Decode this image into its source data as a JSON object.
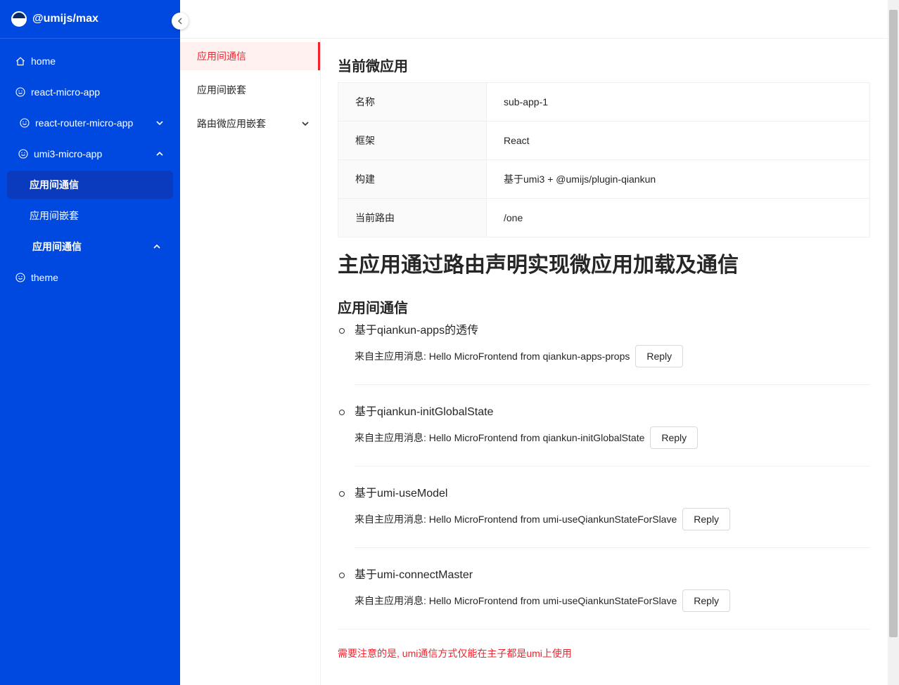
{
  "app": {
    "title": "@umijs/max"
  },
  "sidebar": {
    "items": [
      {
        "label": "home",
        "icon": "home-icon"
      },
      {
        "label": "react-micro-app",
        "icon": "smile-icon"
      },
      {
        "label": "react-router-micro-app",
        "icon": "smile-icon",
        "arrow": "down"
      },
      {
        "label": "umi3-micro-app",
        "icon": "smile-icon",
        "arrow": "up"
      },
      {
        "label": "应用间通信",
        "child": true,
        "active": true
      },
      {
        "label": "应用间嵌套",
        "child": true
      },
      {
        "label": "应用间通信",
        "child": true,
        "arrow": "up"
      },
      {
        "label": "theme",
        "icon": "smile-icon"
      }
    ]
  },
  "subsidebar": {
    "items": [
      {
        "label": "应用间通信",
        "active": true
      },
      {
        "label": "应用间嵌套"
      },
      {
        "label": "路由微应用嵌套",
        "arrow": "down"
      }
    ]
  },
  "main": {
    "current_title": "当前微应用",
    "details": [
      {
        "label": "名称",
        "value": "sub-app-1"
      },
      {
        "label": "框架",
        "value": "React"
      },
      {
        "label": "构建",
        "value": "基于umi3 + @umijs/plugin-qiankun"
      },
      {
        "label": "当前路由",
        "value": "/one"
      }
    ],
    "heading": "主应用通过路由声明实现微应用加载及通信",
    "comm_title": "应用间通信",
    "comm_items": [
      {
        "title": "基于qiankun-apps的透传",
        "message": "来自主应用消息: Hello MicroFrontend from qiankun-apps-props",
        "button": "Reply"
      },
      {
        "title": "基于qiankun-initGlobalState",
        "message": "来自主应用消息: Hello MicroFrontend from qiankun-initGlobalState",
        "button": "Reply"
      },
      {
        "title": "基于umi-useModel",
        "message": "来自主应用消息: Hello MicroFrontend from umi-useQiankunStateForSlave",
        "button": "Reply"
      },
      {
        "title": "基于umi-connectMaster",
        "message": "来自主应用消息: Hello MicroFrontend from umi-useQiankunStateForSlave",
        "button": "Reply"
      }
    ],
    "note": "需要注意的是, umi通信方式仅能在主子都是umi上使用"
  },
  "colors": {
    "sidebar_bg": "#0049e0",
    "accent": "#f5222d"
  }
}
